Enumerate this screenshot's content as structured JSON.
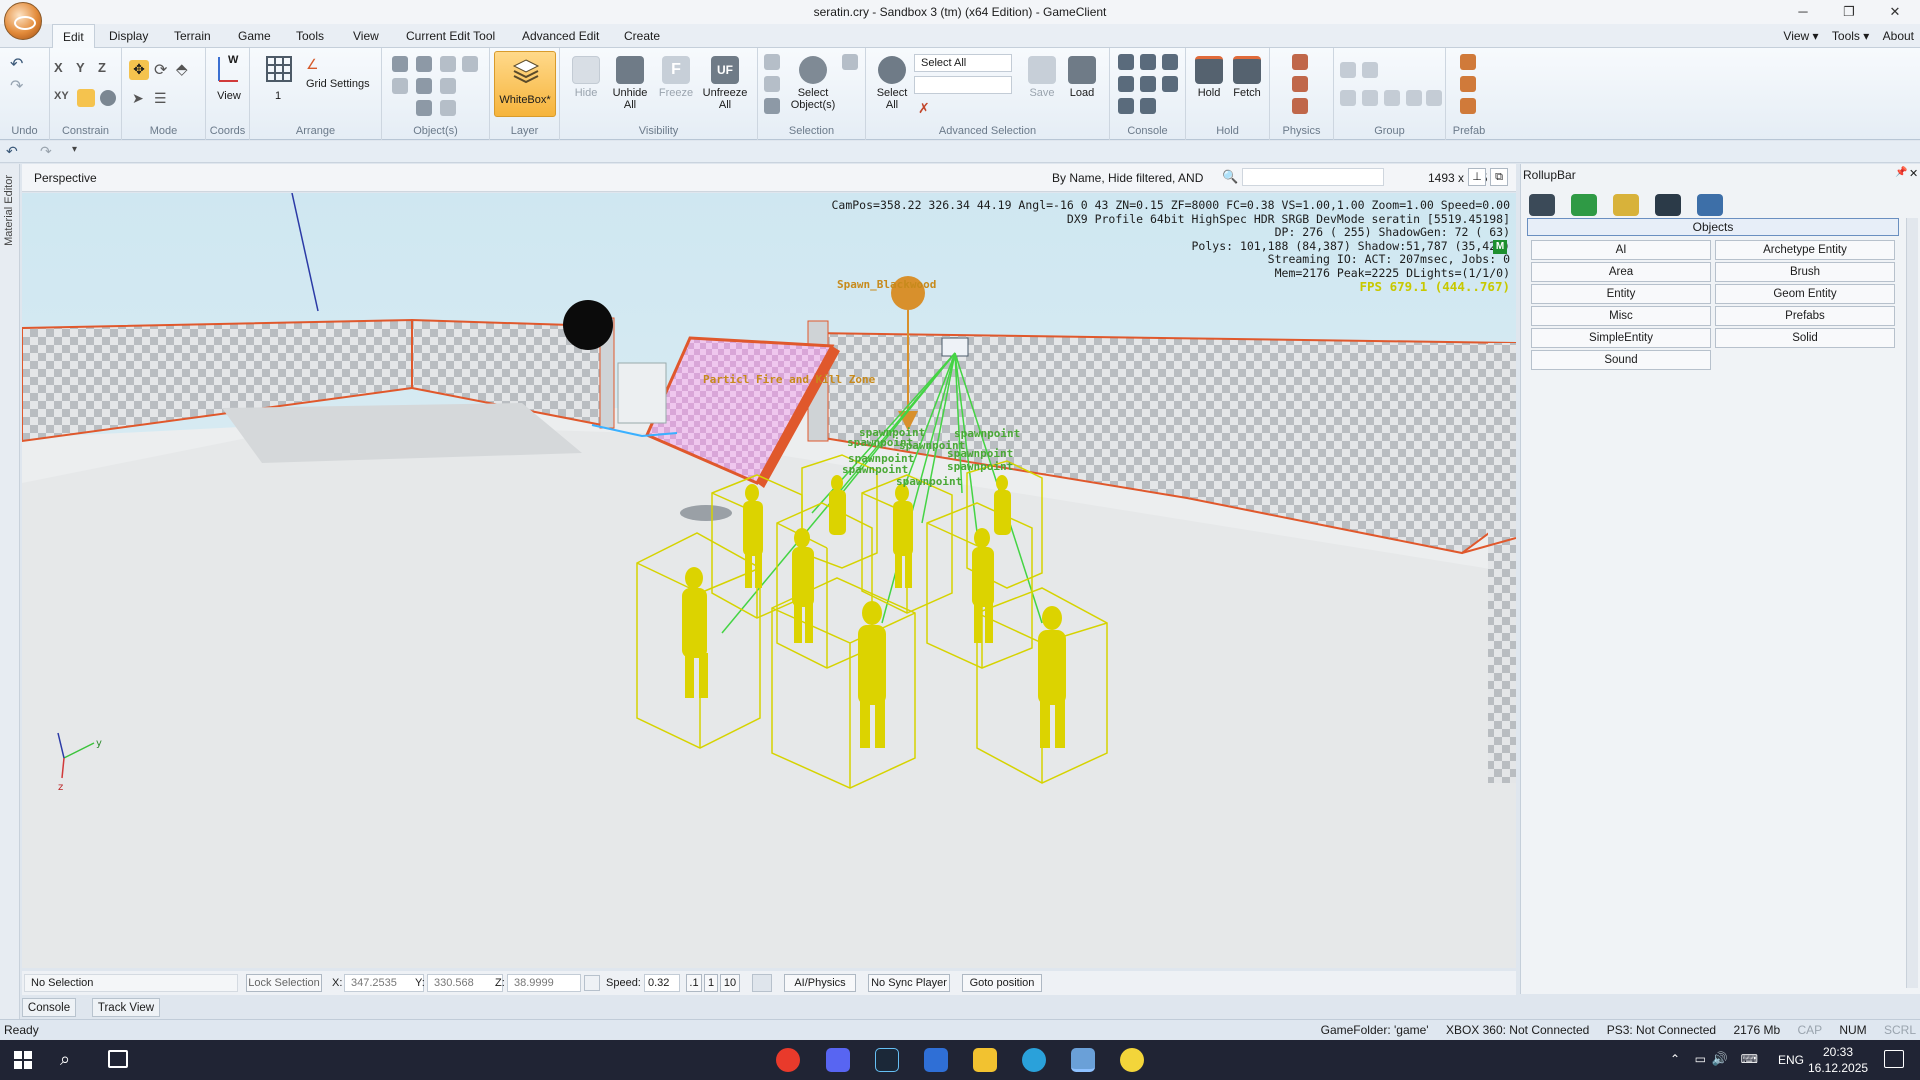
{
  "window": {
    "title": "seratin.cry - Sandbox 3 (tm) (x64 Edition) - GameClient",
    "minimize": "─",
    "restore": "❐",
    "close": "✕"
  },
  "menu": {
    "tabs": [
      "Edit",
      "Display",
      "Terrain",
      "Game",
      "Tools",
      "View",
      "Current Edit Tool",
      "Advanced Edit",
      "Create"
    ],
    "right": [
      "View ▾",
      "Tools ▾",
      "About"
    ]
  },
  "ribbon": {
    "groups": [
      "Undo",
      "Constrain",
      "Mode",
      "Coords",
      "Arrange",
      "Object(s)",
      "Layer",
      "Visibility",
      "Selection",
      "Advanced Selection",
      "Console",
      "Hold",
      "Physics",
      "Group",
      "Prefab"
    ],
    "constrain": [
      "X",
      "Y",
      "Z",
      "XY"
    ],
    "coords_view": "View",
    "coords_w": "W",
    "arrange_value": "1",
    "grid_settings": "Grid Settings",
    "whitebox": "WhiteBox*",
    "hide": "Hide",
    "unhide_all": "Unhide All",
    "freeze": "Freeze",
    "unfreeze_all": "Unfreeze All",
    "select_objects": "Select Object(s)",
    "select_all": "Select All",
    "select_all_dropdown": "Select All",
    "save": "Save",
    "load": "Load",
    "hold": "Hold",
    "fetch": "Fetch"
  },
  "viewport": {
    "title": "Perspective",
    "filter": "By Name, Hide filtered, AND",
    "resolution": "1493 x 775",
    "hud": [
      "CamPos=358.22 326.34 44.19 Angl=-16  0  43 ZN=0.15 ZF=8000 FC=0.38 VS=1.00,1.00 Zoom=1.00 Speed=0.00",
      "DX9 Profile 64bit HighSpec HDR SRGB DevMode seratin [5519.45198]",
      "DP:  276 ( 255) ShadowGen: 72 ( 63)",
      "Polys: 101,188 (84,387) Shadow:51,787 (35,424)",
      "Streaming IO: ACT: 207msec, Jobs: 0",
      "Mem=2176 Peak=2225 DLights=(1/1/0)"
    ],
    "fps": "FPS 679.1 (444..767)",
    "m_badge": "M",
    "labels": {
      "spawn": "Spawn_Blackwood",
      "fire": "Particl Fire and Kill Zone",
      "sp": [
        "spawnpoint",
        "spawnpoint",
        "spawnpoint",
        "spawnpoint",
        "spawnpoint",
        "spawnpoint",
        "spawnpoint",
        "spawnpoint",
        "spawnpoint"
      ]
    }
  },
  "left_strip": "Material Editor",
  "rollup": {
    "title": "RollupBar",
    "pin": "📌",
    "close": "✕",
    "section": "Objects",
    "buttons": [
      "AI",
      "Archetype Entity",
      "Area",
      "Brush",
      "Entity",
      "Geom Entity",
      "Misc",
      "Prefabs",
      "SimpleEntity",
      "Solid",
      "Sound"
    ]
  },
  "controls": {
    "selection": "No Selection",
    "lock": "Lock Selection",
    "x_label": "X:",
    "x": "347.2535",
    "y_label": "Y:",
    "y": "330.568",
    "z_label": "Z:",
    "z": "38.9999",
    "speed_label": "Speed:",
    "speed": "0.32",
    "s1": ".1",
    "s2": "1",
    "s3": "10",
    "ai_physics": "AI/Physics",
    "sync": "No Sync Player",
    "goto": "Goto position"
  },
  "bottom_tabs": [
    "Console",
    "Track View"
  ],
  "status": {
    "ready": "Ready",
    "right": [
      "GameFolder: 'game'",
      "XBOX 360: Not Connected",
      "PS3: Not Connected",
      "2176 Mb",
      "CAP",
      "NUM",
      "SCRL"
    ]
  },
  "taskbar": {
    "tray_lang": "ENG",
    "time": "20:33",
    "date": "16.12.2025"
  }
}
